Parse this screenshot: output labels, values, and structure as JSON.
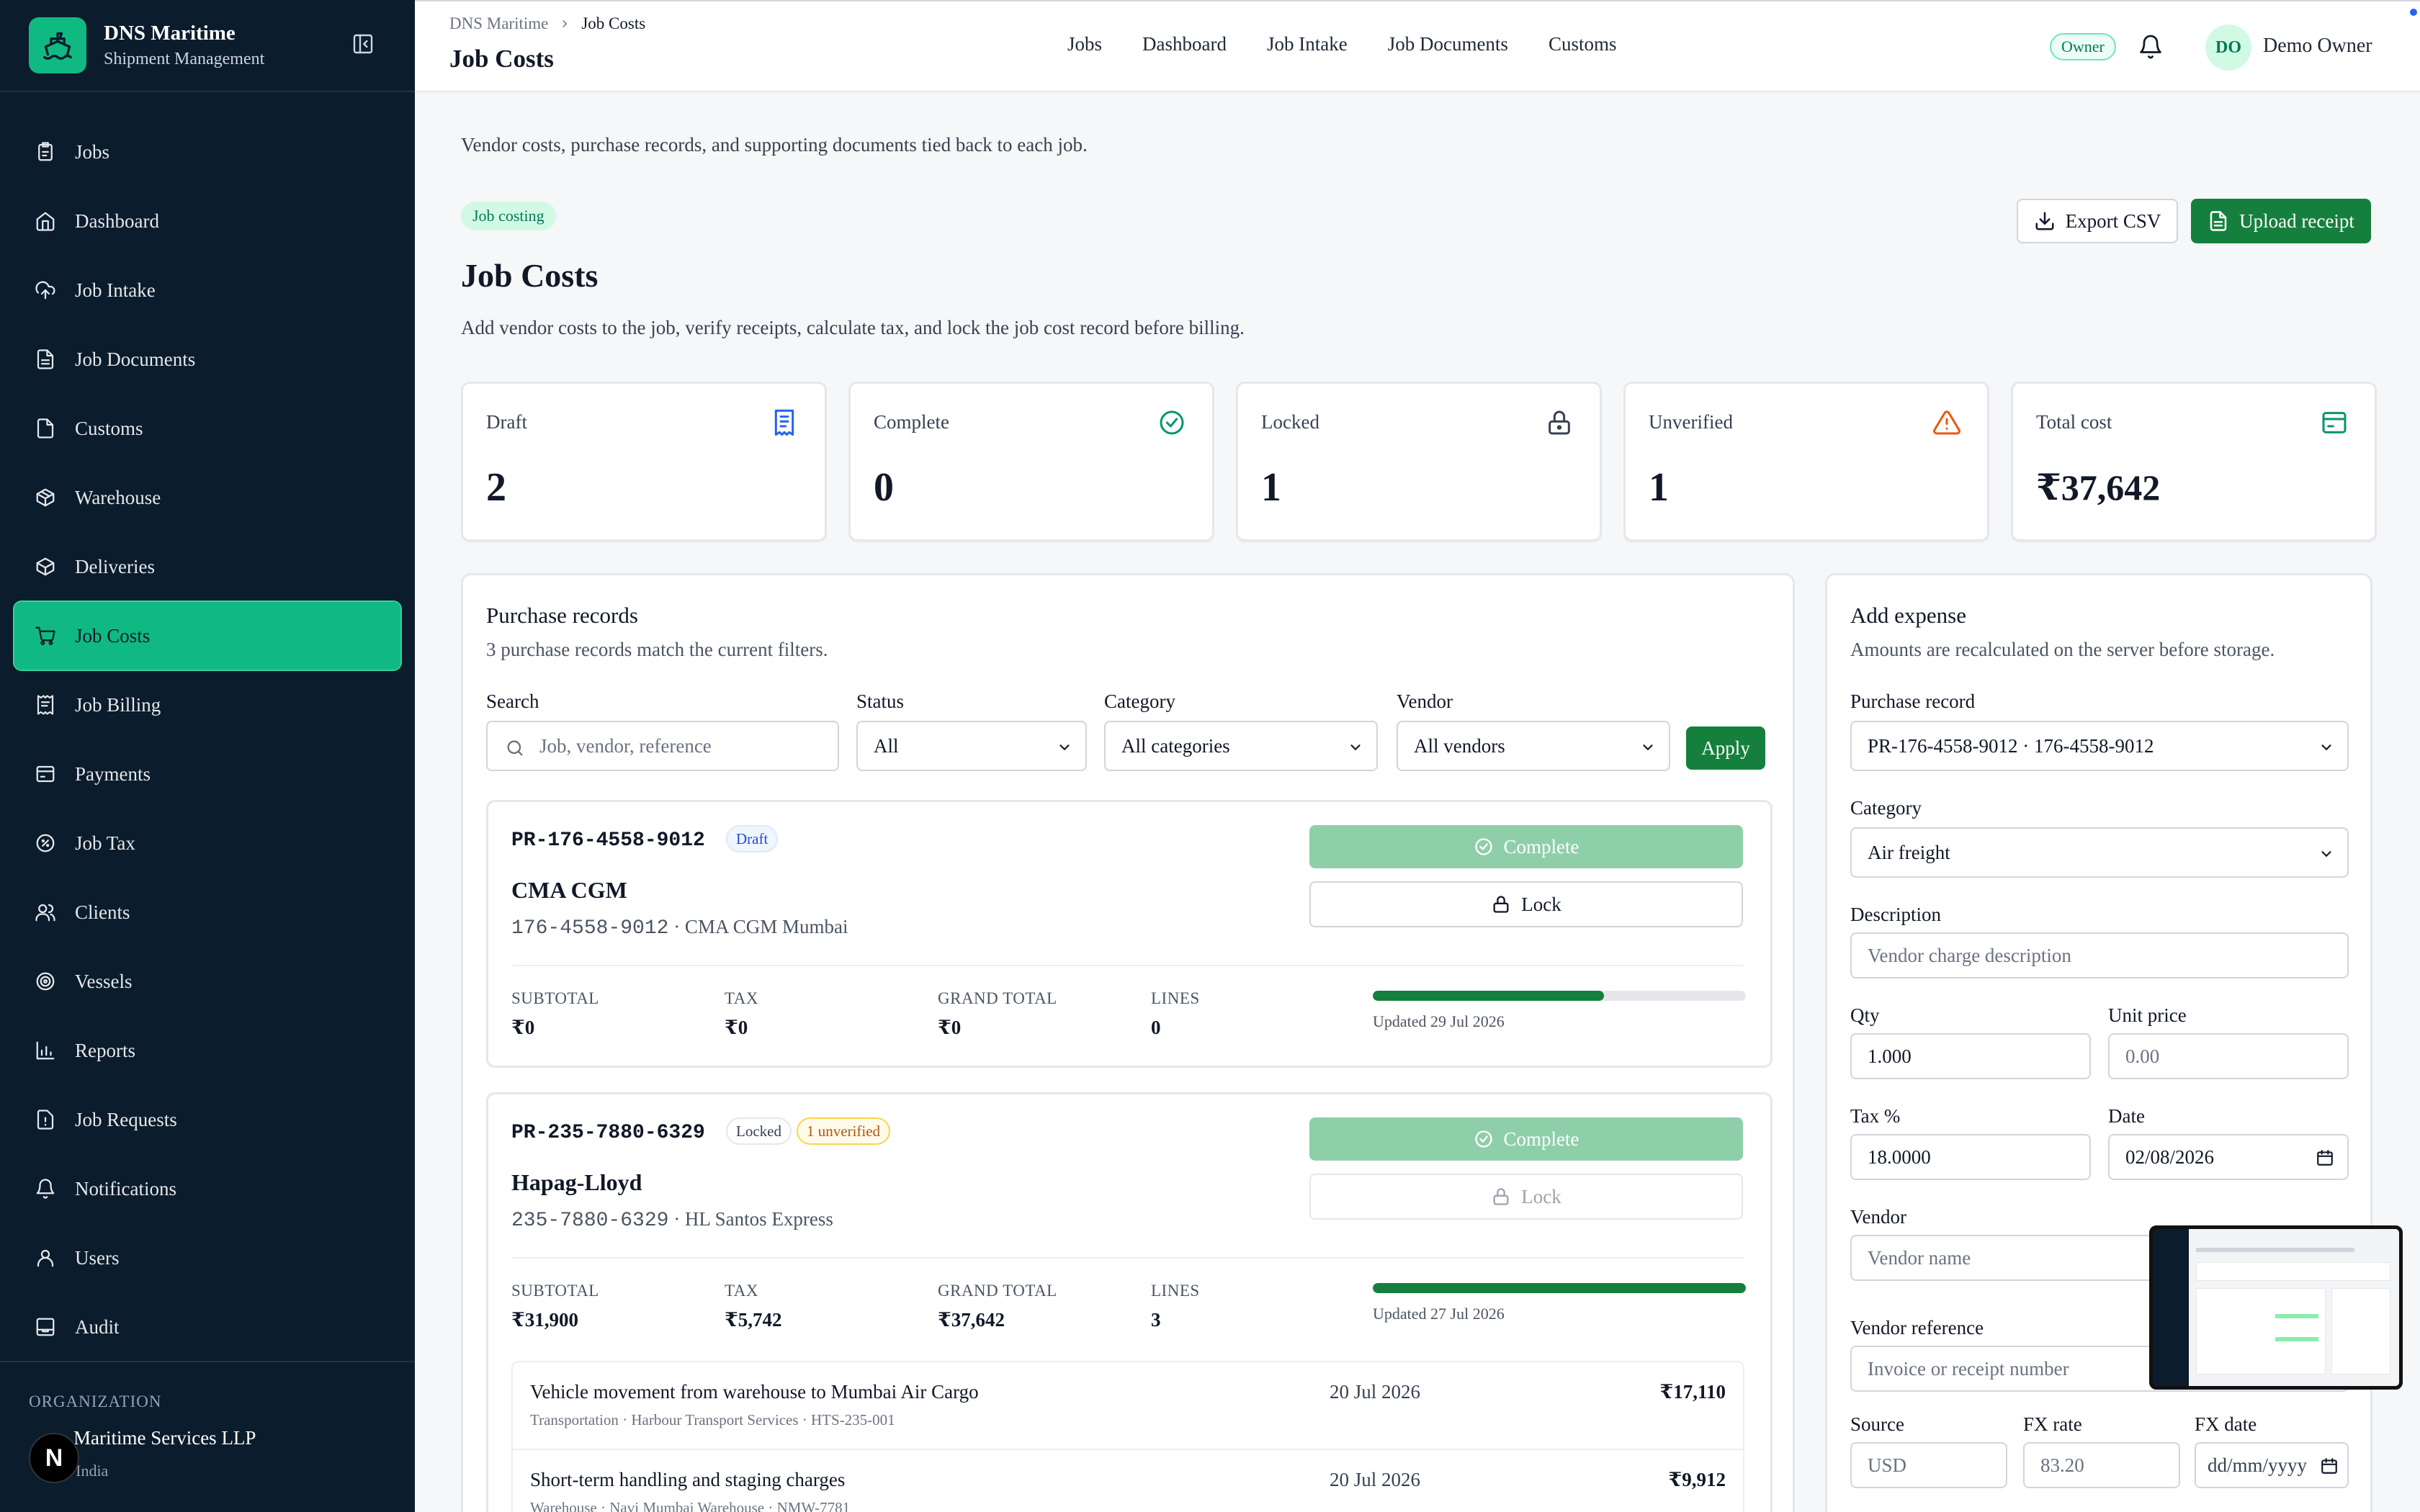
{
  "brand": {
    "title": "DNS Maritime",
    "subtitle": "Shipment Management"
  },
  "sidebar": {
    "items": [
      {
        "label": "Jobs",
        "icon": "clipboard-icon"
      },
      {
        "label": "Dashboard",
        "icon": "home-icon"
      },
      {
        "label": "Job Intake",
        "icon": "upload-cloud-icon"
      },
      {
        "label": "Job Documents",
        "icon": "file-text-icon"
      },
      {
        "label": "Customs",
        "icon": "file-icon"
      },
      {
        "label": "Warehouse",
        "icon": "package-icon"
      },
      {
        "label": "Deliveries",
        "icon": "package-check-icon"
      },
      {
        "label": "Job Costs",
        "icon": "cart-icon",
        "active": true
      },
      {
        "label": "Job Billing",
        "icon": "receipt-icon"
      },
      {
        "label": "Payments",
        "icon": "wallet-icon"
      },
      {
        "label": "Job Tax",
        "icon": "percent-icon"
      },
      {
        "label": "Clients",
        "icon": "users-icon"
      },
      {
        "label": "Vessels",
        "icon": "ship-icon"
      },
      {
        "label": "Reports",
        "icon": "bar-chart-icon"
      },
      {
        "label": "Job Requests",
        "icon": "file-alert-icon"
      },
      {
        "label": "Notifications",
        "icon": "bell-icon"
      },
      {
        "label": "Users",
        "icon": "user-icon"
      },
      {
        "label": "Audit",
        "icon": "archive-icon"
      }
    ],
    "org_label": "ORGANIZATION",
    "org_name": "Maritime Services LLP",
    "org_location": "i, India",
    "n_badge": "N"
  },
  "header": {
    "breadcrumb": [
      "DNS Maritime",
      "Job Costs"
    ],
    "title": "Job Costs",
    "nav": [
      "Jobs",
      "Dashboard",
      "Job Intake",
      "Job Documents",
      "Customs"
    ],
    "role": "Owner",
    "avatar_initials": "DO",
    "user_name": "Demo Owner"
  },
  "main": {
    "intro": "Vendor costs, purchase records, and supporting documents tied back to each job.",
    "badge": "Job costing",
    "title": "Job Costs",
    "subtitle": "Add vendor costs to the job, verify receipts, calculate tax, and lock the job cost record before billing.",
    "export_label": "Export CSV",
    "upload_label": "Upload receipt"
  },
  "stats": [
    {
      "label": "Draft",
      "value": "2",
      "icon": "receipt-icon",
      "color": "#2563eb"
    },
    {
      "label": "Complete",
      "value": "0",
      "icon": "check-circle-icon",
      "color": "#059669"
    },
    {
      "label": "Locked",
      "value": "1",
      "icon": "lock-icon",
      "color": "#374151"
    },
    {
      "label": "Unverified",
      "value": "1",
      "icon": "alert-triangle-icon",
      "color": "#ea580c"
    },
    {
      "label": "Total cost",
      "value": "₹37,642",
      "icon": "wallet-icon",
      "color": "#059669"
    }
  ],
  "purchase_records": {
    "title": "Purchase records",
    "subtitle": "3 purchase records match the current filters.",
    "filters": {
      "search_label": "Search",
      "search_placeholder": "Job, vendor, reference",
      "status_label": "Status",
      "status_value": "All",
      "category_label": "Category",
      "category_value": "All categories",
      "vendor_label": "Vendor",
      "vendor_value": "All vendors",
      "apply_label": "Apply"
    },
    "metric_labels": {
      "subtotal": "SUBTOTAL",
      "tax": "TAX",
      "grand_total": "GRAND TOTAL",
      "lines": "LINES"
    },
    "actions": {
      "complete": "Complete",
      "lock": "Lock"
    },
    "records": [
      {
        "id": "PR-176-4558-9012",
        "tags": [
          "Draft"
        ],
        "vendor": "CMA CGM",
        "reference": "176-4558-9012",
        "reference_detail": " · CMA CGM Mumbai",
        "subtotal": "₹0",
        "tax": "₹0",
        "grand_total": "₹0",
        "lines": "0",
        "progress": 0.62,
        "updated": "Updated 29 Jul 2026"
      },
      {
        "id": "PR-235-7880-6329",
        "tags": [
          "Locked",
          "1 unverified"
        ],
        "vendor": "Hapag-Lloyd",
        "reference": "235-7880-6329",
        "reference_detail": " · HL Santos Express",
        "subtotal": "₹31,900",
        "tax": "₹5,742",
        "grand_total": "₹37,642",
        "lines": "3",
        "progress": 1.0,
        "updated": "Updated 27 Jul 2026",
        "line_items": [
          {
            "description": "Vehicle movement from warehouse to Mumbai Air Cargo",
            "meta": "Transportation · Harbour Transport Services · HTS-235-001",
            "date": "20 Jul 2026",
            "amount": "₹17,110"
          },
          {
            "description": "Short-term handling and staging charges",
            "meta": "Warehouse · Navi Mumbai Warehouse · NMW-7781",
            "date": "20 Jul 2026",
            "amount": "₹9,912"
          }
        ]
      }
    ]
  },
  "add_expense": {
    "title": "Add expense",
    "subtitle": "Amounts are recalculated on the server before storage.",
    "purchase_record_label": "Purchase record",
    "purchase_record_value": "PR-176-4558-9012 · 176-4558-9012",
    "category_label": "Category",
    "category_value": "Air freight",
    "description_label": "Description",
    "description_placeholder": "Vendor charge description",
    "qty_label": "Qty",
    "qty_value": "1.000",
    "unit_price_label": "Unit price",
    "unit_price_placeholder": "0.00",
    "tax_label": "Tax %",
    "tax_value": "18.0000",
    "date_label": "Date",
    "date_value": "02/08/2026",
    "vendor_label": "Vendor",
    "vendor_placeholder": "Vendor name",
    "vendor_ref_label": "Vendor reference",
    "vendor_ref_placeholder": "Invoice or receipt number",
    "source_label": "Source",
    "source_placeholder": "USD",
    "fx_rate_label": "FX rate",
    "fx_rate_placeholder": "83.20",
    "fx_date_label": "FX date",
    "fx_date_placeholder": "dd/mm/yyyy"
  }
}
